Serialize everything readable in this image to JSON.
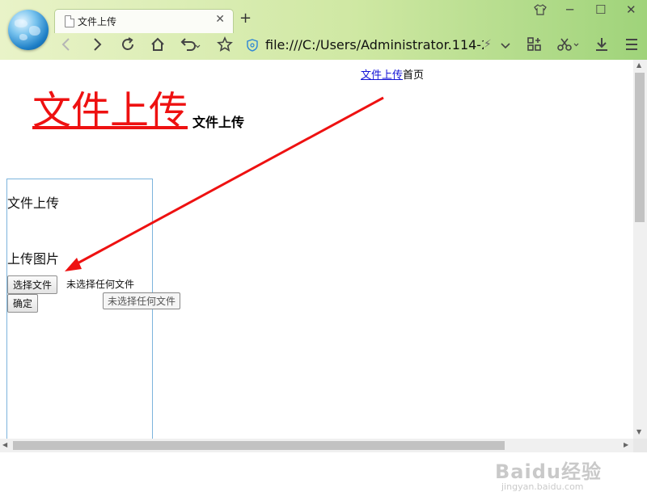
{
  "browser": {
    "tab": {
      "title": "文件上传"
    },
    "new_tab_icon": "plus-icon",
    "address": {
      "url": "file:///C:/Users/Administrator.114-2("
    },
    "toolbar_icons": [
      "back-icon",
      "forward-icon",
      "reload-icon",
      "home-icon",
      "undo-icon",
      "star-icon",
      "apps-icon",
      "cut-icon",
      "download-icon",
      "menu-icon"
    ]
  },
  "page": {
    "nav": {
      "link": "文件上传",
      "home": "首页"
    },
    "title_big": "文件上传",
    "title_small": "文件上传",
    "form": {
      "heading": "文件上传",
      "label": "上传图片",
      "choose_button": "选择文件",
      "no_file": "未选择任何文件",
      "submit": "确定",
      "tooltip": "未选择任何文件"
    }
  },
  "watermark": {
    "brand": "Baidu经验",
    "domain": "jingyan.baidu.com"
  },
  "colors": {
    "title_red": "#ee1111",
    "link_blue": "#1515d6",
    "box_border": "#7cb4dc",
    "chrome_green": "#9fd37a"
  }
}
